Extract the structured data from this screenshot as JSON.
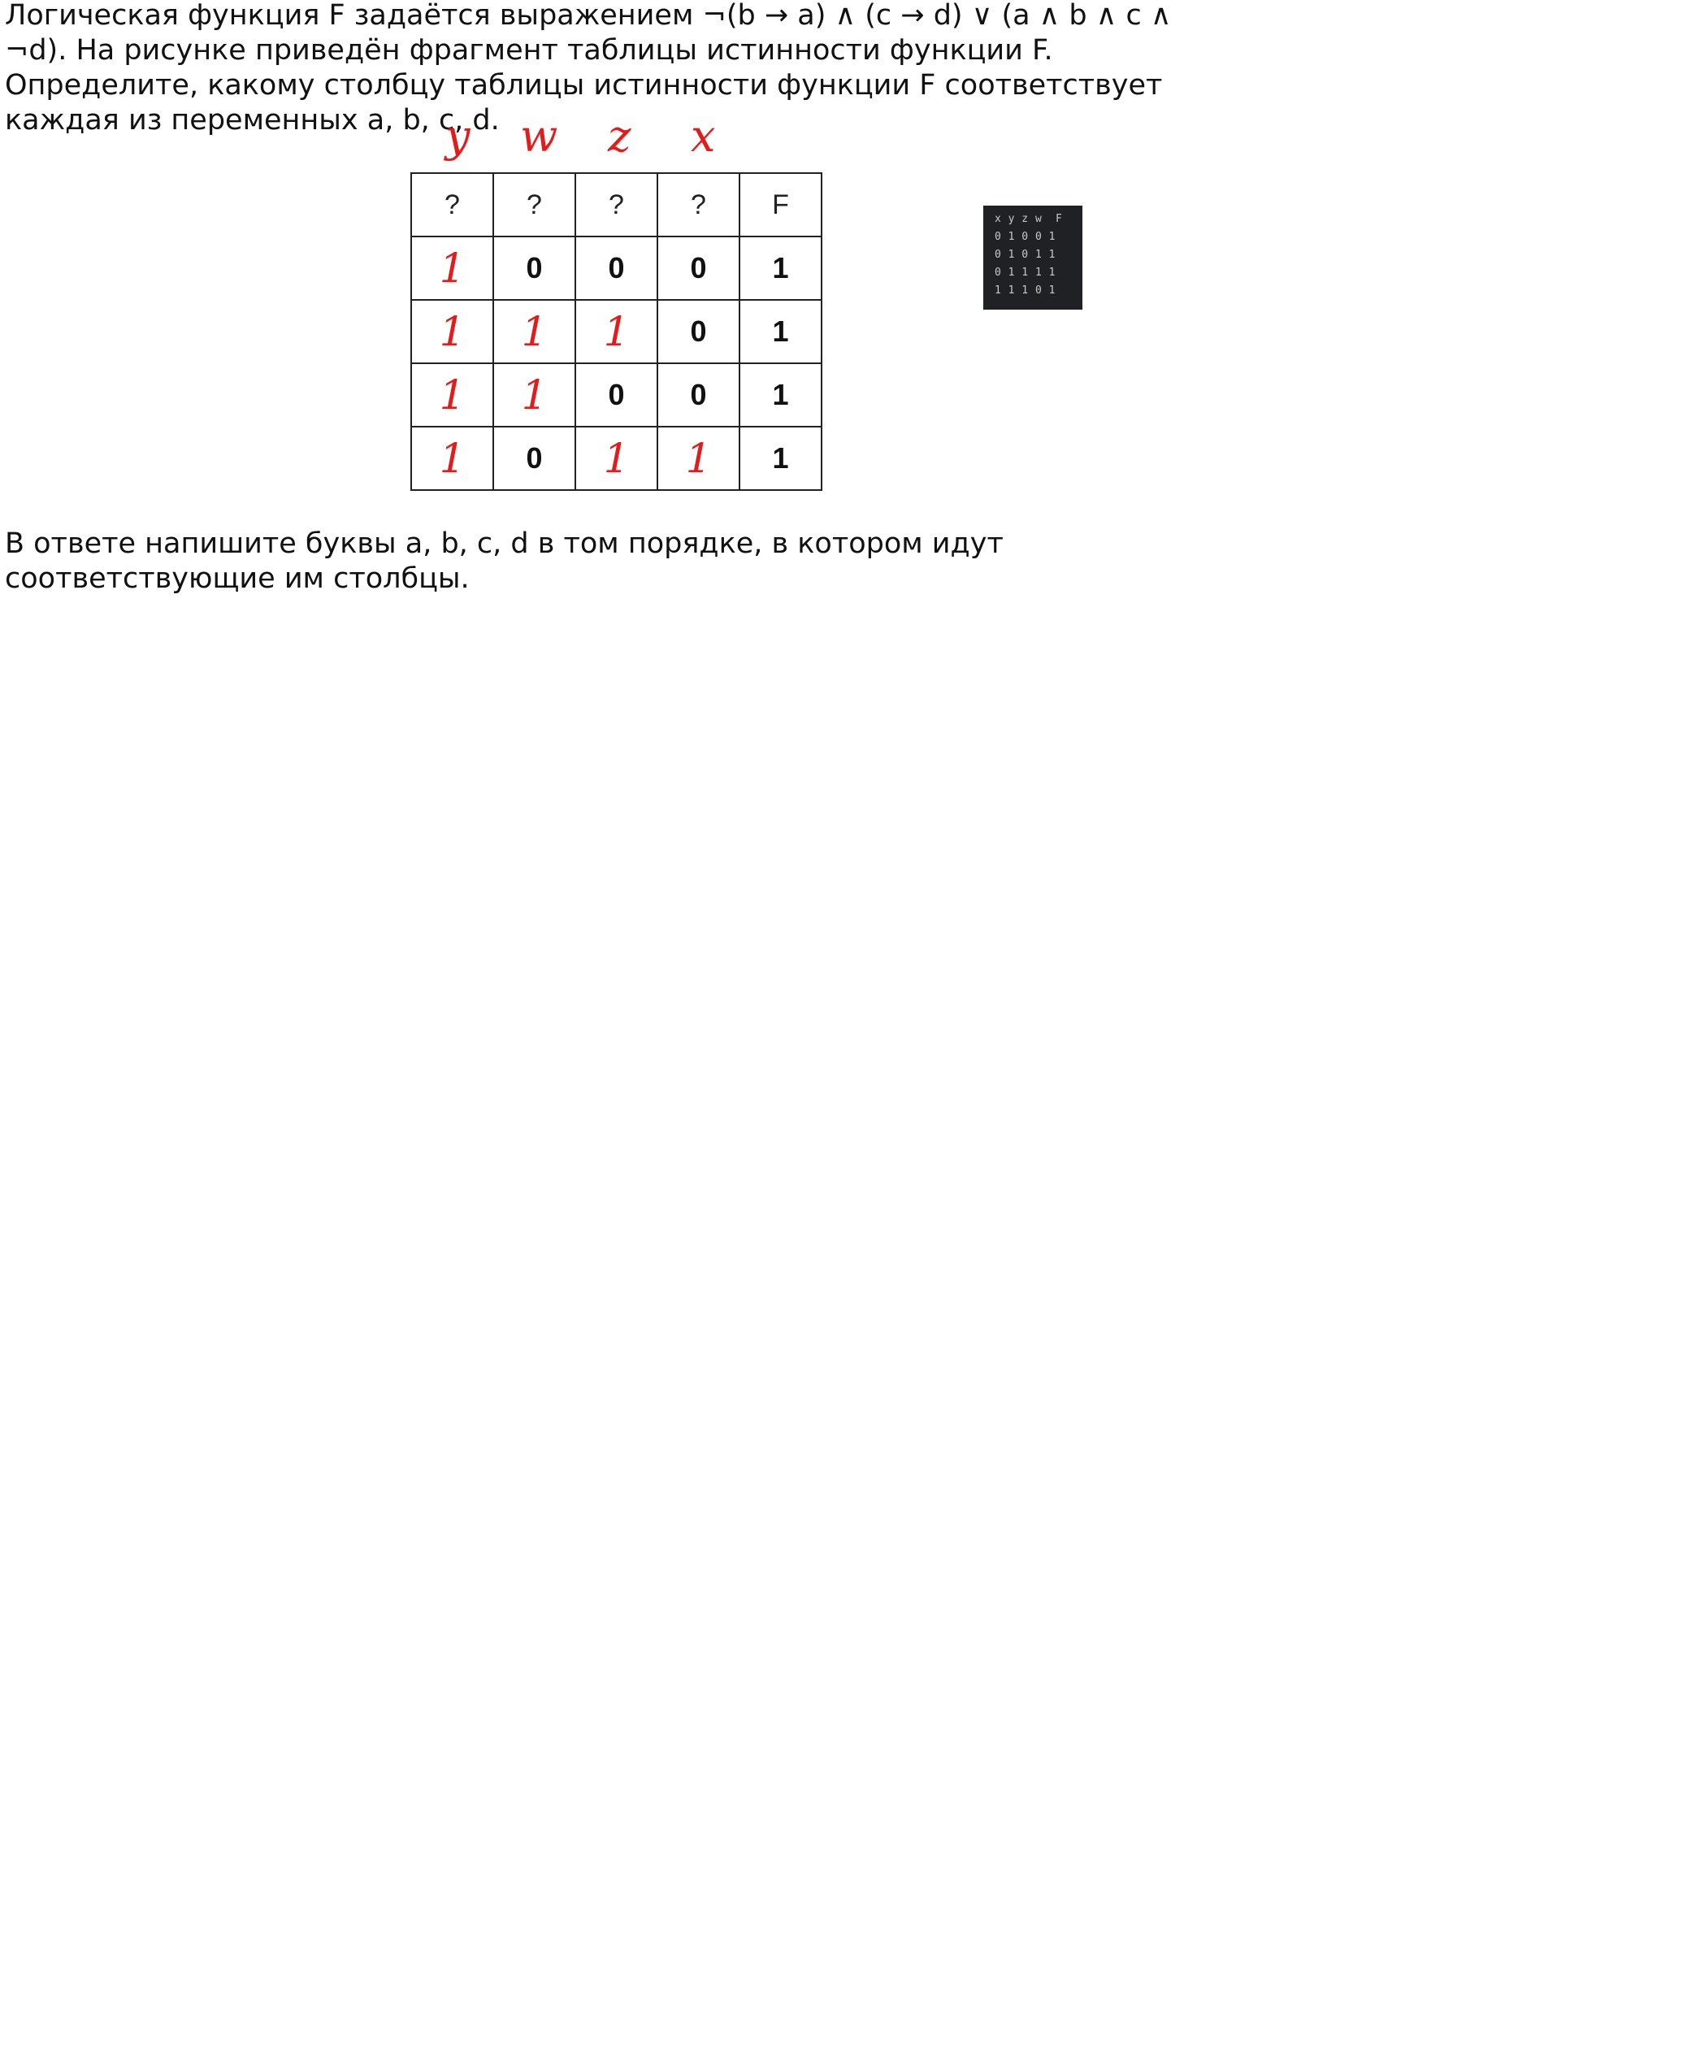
{
  "question": {
    "intro": "Логическая функция F задаётся выражением ¬(b → a) ∧ (c → d) ∨ (a ∧ b ∧ c ∧ ¬d). На рисунке приведён фрагмент таблицы истинности функции F. Определите, какому столбцу таблицы истинности функции F соответствует каждая из переменных a, b, c, d.",
    "answer_prompt": "В ответе напишите буквы a, b, c, d в том порядке, в котором идут соответствующие им столбцы."
  },
  "handwritten_labels": [
    "y",
    "w",
    "z",
    "x"
  ],
  "table": {
    "headers": [
      "?",
      "?",
      "?",
      "?",
      "F"
    ],
    "rows": [
      [
        {
          "v": "1",
          "hw": true
        },
        {
          "v": "0",
          "hw": false
        },
        {
          "v": "0",
          "hw": false
        },
        {
          "v": "0",
          "hw": false
        },
        {
          "v": "1",
          "hw": false
        }
      ],
      [
        {
          "v": "1",
          "hw": true
        },
        {
          "v": "1",
          "hw": true
        },
        {
          "v": "1",
          "hw": true
        },
        {
          "v": "0",
          "hw": false
        },
        {
          "v": "1",
          "hw": false
        }
      ],
      [
        {
          "v": "1",
          "hw": true
        },
        {
          "v": "1",
          "hw": true
        },
        {
          "v": "0",
          "hw": false
        },
        {
          "v": "0",
          "hw": false
        },
        {
          "v": "1",
          "hw": false
        }
      ],
      [
        {
          "v": "1",
          "hw": true
        },
        {
          "v": "0",
          "hw": false
        },
        {
          "v": "1",
          "hw": true
        },
        {
          "v": "1",
          "hw": true
        },
        {
          "v": "1",
          "hw": false
        }
      ]
    ]
  },
  "code_output": {
    "lines": [
      "x y z w  F",
      "0 1 0 0 1",
      "0 1 0 1 1",
      "0 1 1 1 1",
      "1 1 1 0 1"
    ]
  },
  "colors": {
    "handwriting": "#e41b1b",
    "code_background": "#1f2124"
  }
}
